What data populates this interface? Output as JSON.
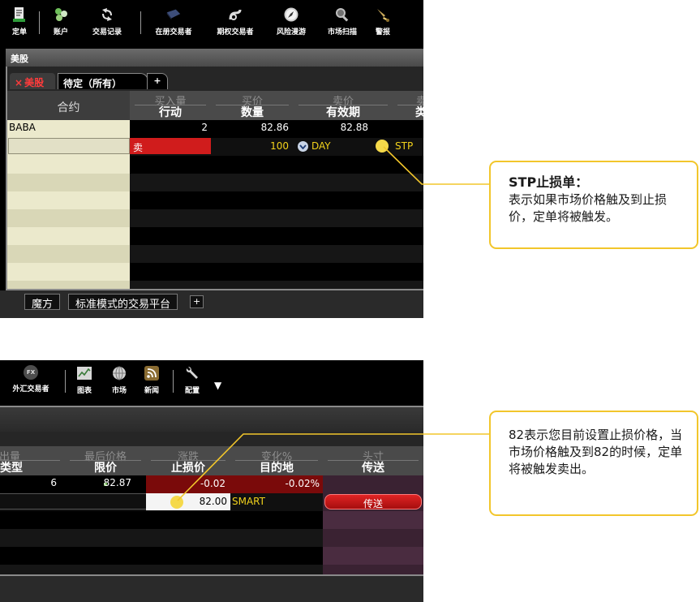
{
  "window1": {
    "toolbar": [
      {
        "label": "定单",
        "icon": "order-document-icon"
      },
      {
        "label": "账户",
        "icon": "account-icon"
      },
      {
        "label": "交易记录",
        "icon": "trade-log-icon"
      },
      {
        "label": "在册交易者",
        "icon": "book-trader-icon"
      },
      {
        "label": "期权交易者",
        "icon": "option-trader-icon"
      },
      {
        "label": "风险漫游",
        "icon": "risk-navigator-icon"
      },
      {
        "label": "市场扫描",
        "icon": "market-scanner-icon"
      },
      {
        "label": "警报",
        "icon": "alert-bell-icon"
      }
    ],
    "pane_title": "美股",
    "tabs": {
      "active": "美股",
      "close": "×",
      "second": "待定（所有）",
      "add": "+"
    },
    "columns": [
      {
        "top": "",
        "bottom": "合约"
      },
      {
        "top": "买入量",
        "bottom": "行动"
      },
      {
        "top": "买价",
        "bottom": "数量"
      },
      {
        "top": "卖价",
        "bottom": "有效期"
      },
      {
        "top": "卖",
        "bottom": "类"
      }
    ],
    "row1": {
      "symbol": "BABA",
      "bid_size": "2",
      "bid": "82.86",
      "ask": "82.88"
    },
    "row2": {
      "action": "卖",
      "quantity": "100",
      "tif": "DAY",
      "type": "STP"
    },
    "bottom_tabs": [
      "魔方",
      "标准模式的交易平台",
      "+"
    ]
  },
  "window2": {
    "toolbar": [
      {
        "label": "外汇交易者",
        "icon": "fx-trader-icon",
        "badge": "FX"
      },
      {
        "label": "图表",
        "icon": "chart-icon"
      },
      {
        "label": "市场",
        "icon": "globe-icon"
      },
      {
        "label": "新闻",
        "icon": "rss-news-icon"
      },
      {
        "label": "配置",
        "icon": "wrench-icon"
      }
    ],
    "overflow": "▼",
    "columns": [
      {
        "top": "卖出量",
        "bottom": "类型"
      },
      {
        "top": "最后价格",
        "bottom": "限价"
      },
      {
        "top": "涨跌",
        "bottom": "止损价"
      },
      {
        "top": "变化%",
        "bottom": "目的地"
      },
      {
        "top": "头寸",
        "bottom": "传送"
      }
    ],
    "row1": {
      "ask_size": "6",
      "last": "82.87",
      "change": "-0.02",
      "change_pct": "-0.02%"
    },
    "row2": {
      "stop_price": "82.00",
      "destination": "SMART",
      "transmit": "传送"
    }
  },
  "callout1": {
    "title": "STP止损单：",
    "text": "表示如果市场价格触及到止损价，定单将被触发。"
  },
  "callout2": {
    "text": "82表示您目前设置止损价格，当市场价格触及到82的时候，定单将被触发卖出。"
  },
  "colors": {
    "accent": "#f2c62b",
    "sell_red": "#d01c1c",
    "stop_dark_red": "#7a0a0a",
    "transmit_red": "#cc1111",
    "highlight_yellow": "#f5d94a"
  }
}
